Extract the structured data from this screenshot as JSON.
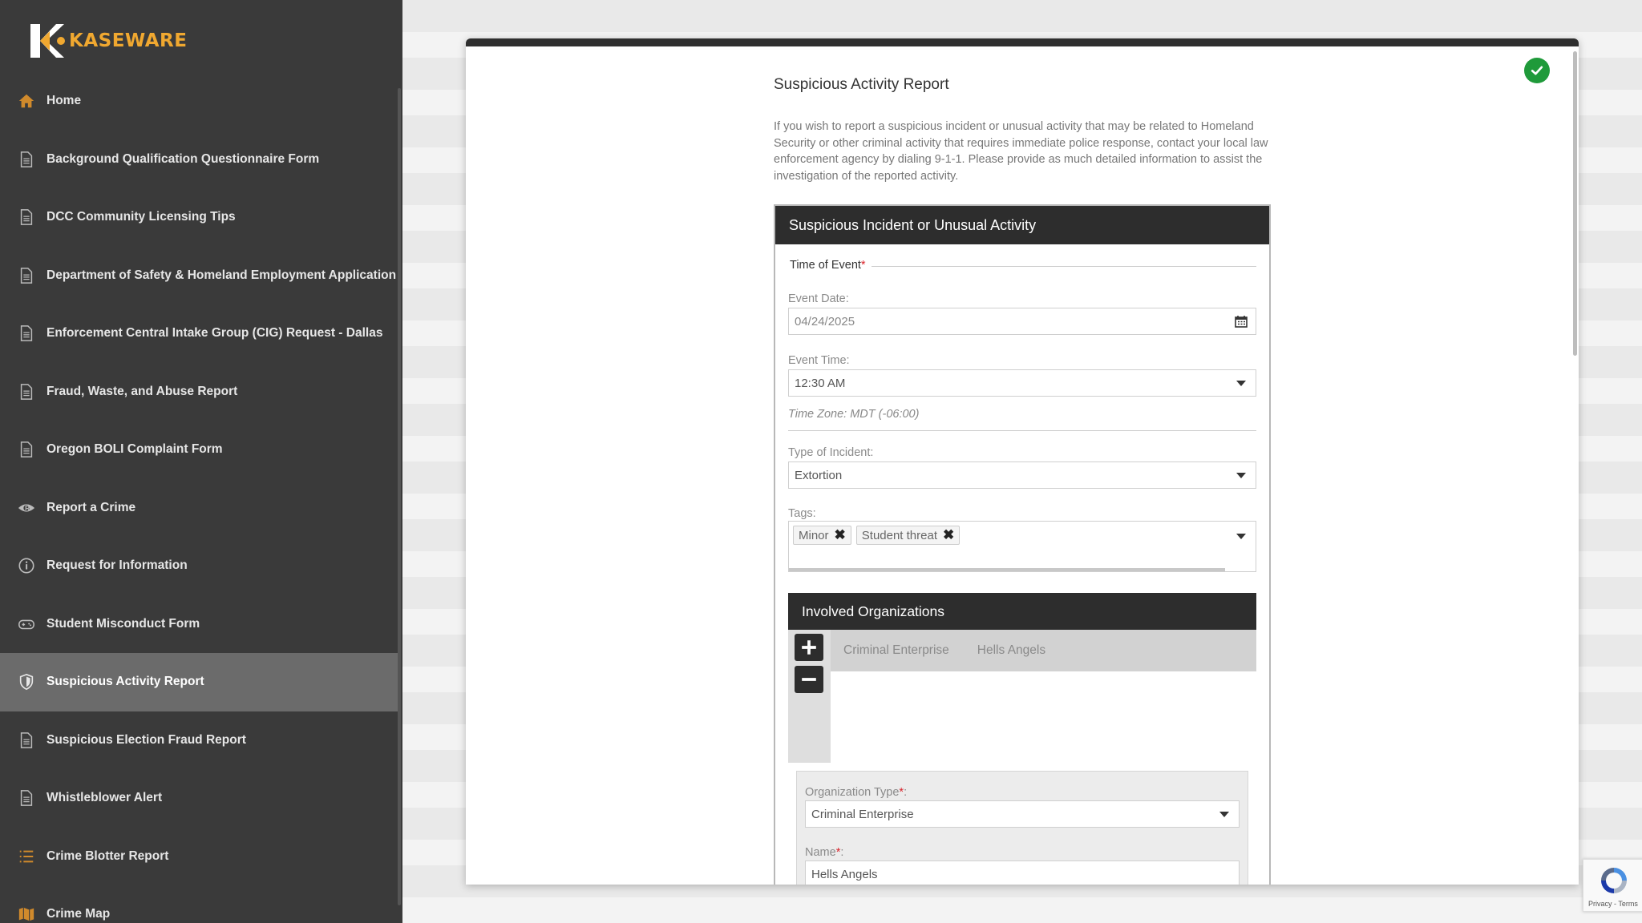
{
  "brand": {
    "name": "KASEWARE",
    "accent": "#f0a830"
  },
  "sidebar": {
    "items": [
      {
        "label": "Home",
        "icon": "home-icon"
      },
      {
        "label": "Background Qualification Questionnaire Form",
        "icon": "document-icon"
      },
      {
        "label": "DCC Community Licensing Tips",
        "icon": "document-icon"
      },
      {
        "label": "Department of Safety & Homeland Employment Application",
        "icon": "document-icon"
      },
      {
        "label": "Enforcement Central Intake Group (CIG) Request - Dallas",
        "icon": "document-icon"
      },
      {
        "label": "Fraud, Waste, and Abuse Report",
        "icon": "document-icon"
      },
      {
        "label": "Oregon BOLI Complaint Form",
        "icon": "document-icon"
      },
      {
        "label": "Report a Crime",
        "icon": "eye-icon"
      },
      {
        "label": "Request for Information",
        "icon": "info-icon"
      },
      {
        "label": "Student Misconduct Form",
        "icon": "gamepad-icon"
      },
      {
        "label": "Suspicious Activity Report",
        "icon": "shield-icon",
        "active": true
      },
      {
        "label": "Suspicious Election Fraud Report",
        "icon": "document-icon"
      },
      {
        "label": "Whistleblower Alert",
        "icon": "document-icon"
      },
      {
        "label": "Crime Blotter Report",
        "icon": "list-icon"
      },
      {
        "label": "Crime Map",
        "icon": "map-icon"
      }
    ]
  },
  "page": {
    "title": "Suspicious Activity Report",
    "intro": "If you wish to report a suspicious incident or unusual activity that may be related to Homeland Security or other criminal activity that requires immediate police response, contact your local law enforcement agency by dialing 9-1-1. Please provide as much detailed information to assist the investigation of the reported activity.",
    "status_color": "#1f9a3a"
  },
  "form": {
    "section_title": "Suspicious Incident or Unusual Activity",
    "time_of_event_label": "Time of Event",
    "event_date_label": "Event Date:",
    "event_date_value": "04/24/2025",
    "event_time_label": "Event Time:",
    "event_time_value": "12:30 AM",
    "time_zone": "Time Zone: MDT (-06:00)",
    "incident_type_label": "Type of Incident:",
    "incident_type_value": "Extortion",
    "tags_label": "Tags:",
    "tags": [
      "Minor",
      "Student threat"
    ],
    "orgs_section_title": "Involved Organizations",
    "org_tabs": [
      "Criminal Enterprise",
      "Hells Angels"
    ],
    "org_type_label": "Organization Type",
    "org_type_value": "Criminal Enterprise",
    "org_name_label": "Name",
    "org_name_value": "Hells Angels"
  },
  "recaptcha": {
    "text": "Privacy - Terms"
  }
}
